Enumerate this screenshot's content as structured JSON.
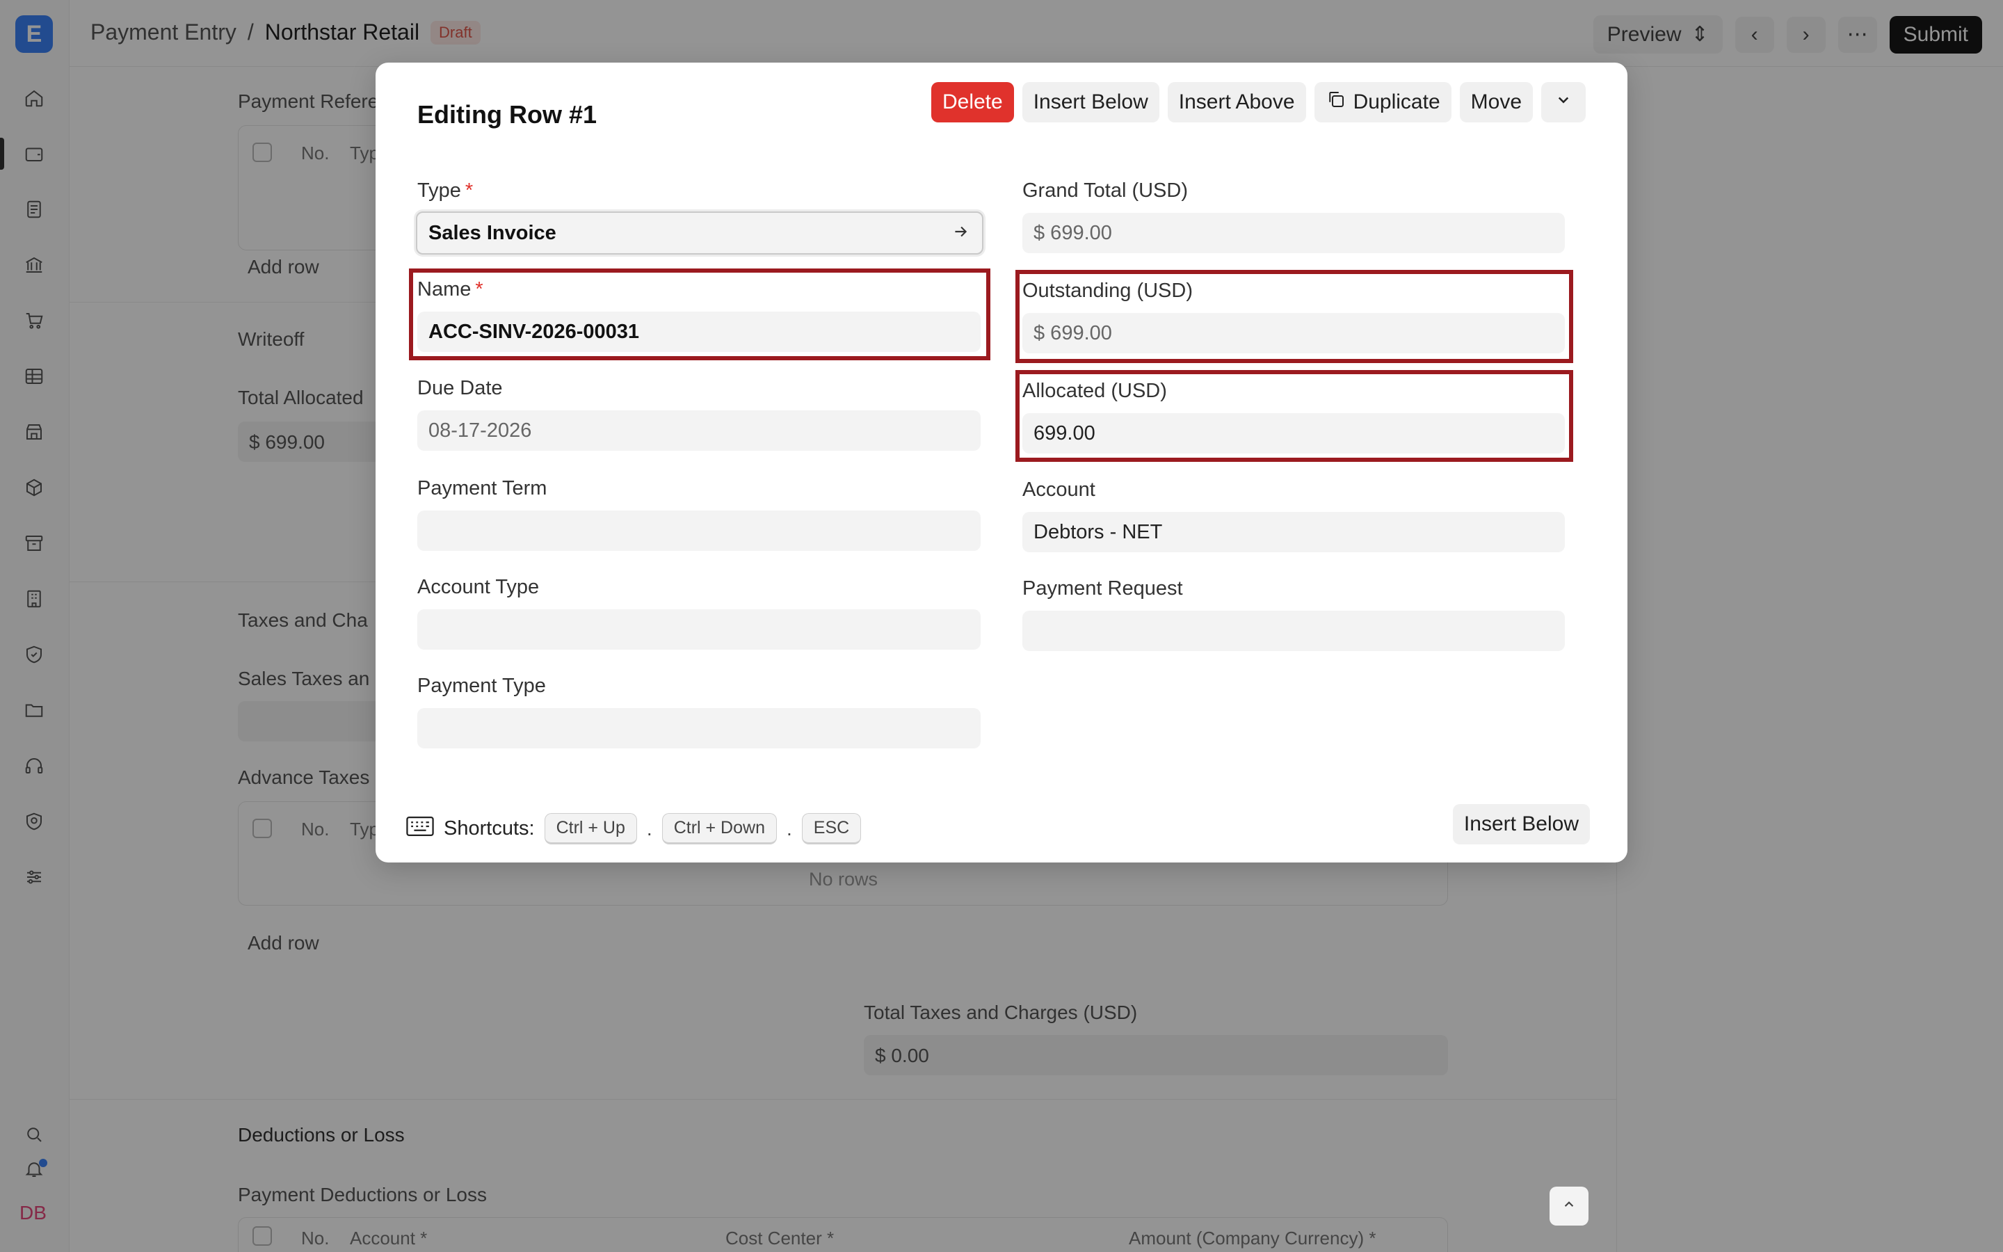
{
  "app": {
    "logo_letter": "E",
    "user_initials": "DB"
  },
  "topbar": {
    "breadcrumb_parent": "Payment Entry",
    "breadcrumb_sep": "/",
    "breadcrumb_doc": "Northstar Retail",
    "status_badge": "Draft",
    "preview_label": "Preview",
    "submit_label": "Submit"
  },
  "background_form": {
    "payment_references_label": "Payment Refere",
    "col_no": "No.",
    "col_type": "Typ",
    "add_row_label": "Add row",
    "writeoff_label": "Writeoff",
    "total_allocated_label": "Total Allocated",
    "total_allocated_value": "$ 699.00",
    "taxes_section_label": "Taxes and Cha",
    "sales_taxes_label": "Sales Taxes an",
    "advance_taxes_label": "Advance Taxes",
    "no_rows_label": "No rows",
    "add_row_label_2": "Add row",
    "total_taxes_label": "Total Taxes and Charges (USD)",
    "total_taxes_value": "$ 0.00",
    "deductions_label": "Deductions or Loss",
    "payment_deductions_label": "Payment Deductions or Loss",
    "ded_col_no": "No.",
    "ded_col_account": "Account *",
    "ded_col_cost_center": "Cost Center *",
    "ded_col_amount": "Amount (Company Currency) *"
  },
  "modal": {
    "title": "Editing Row #1",
    "actions": {
      "delete": "Delete",
      "insert_below": "Insert Below",
      "insert_above": "Insert Above",
      "duplicate": "Duplicate",
      "move": "Move"
    },
    "left_fields": {
      "type_label": "Type",
      "type_value": "Sales Invoice",
      "name_label": "Name",
      "name_value": "ACC-SINV-2026-00031",
      "due_date_label": "Due Date",
      "due_date_value": "08-17-2026",
      "payment_term_label": "Payment Term",
      "payment_term_value": "",
      "account_type_label": "Account Type",
      "account_type_value": "",
      "payment_type_label": "Payment Type",
      "payment_type_value": ""
    },
    "right_fields": {
      "grand_total_label": "Grand Total (USD)",
      "grand_total_value": "$ 699.00",
      "outstanding_label": "Outstanding (USD)",
      "outstanding_value": "$ 699.00",
      "allocated_label": "Allocated (USD)",
      "allocated_value": "699.00",
      "account_label": "Account",
      "account_value": "Debtors - NET",
      "payment_request_label": "Payment Request",
      "payment_request_value": ""
    },
    "required_mark": "*",
    "shortcuts": {
      "label": "Shortcuts:",
      "keys": [
        "Ctrl + Up",
        "Ctrl + Down",
        "ESC"
      ],
      "separator": "."
    },
    "footer_insert_below": "Insert Below"
  },
  "colors": {
    "highlight_border": "#9b1a1f",
    "danger": "#e0322c",
    "accent": "#3b82f6"
  }
}
